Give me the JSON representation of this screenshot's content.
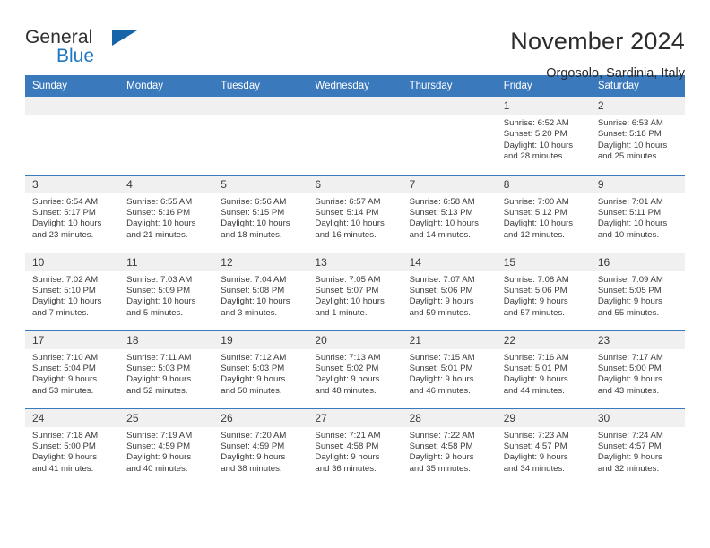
{
  "logo": {
    "text_primary": "General",
    "text_secondary": "Blue",
    "triangle_color": "#1565a8",
    "secondary_color": "#1f78c1"
  },
  "header": {
    "title": "November 2024",
    "subtitle": "Orgosolo, Sardinia, Italy"
  },
  "calendar": {
    "header_bg": "#3b79bd",
    "daynum_bg": "#f0f0f0",
    "weekday_headers": [
      "Sunday",
      "Monday",
      "Tuesday",
      "Wednesday",
      "Thursday",
      "Friday",
      "Saturday"
    ],
    "weeks": [
      [
        {
          "day": "",
          "blank": true
        },
        {
          "day": "",
          "blank": true
        },
        {
          "day": "",
          "blank": true
        },
        {
          "day": "",
          "blank": true
        },
        {
          "day": "",
          "blank": true
        },
        {
          "day": "1",
          "sunrise": "Sunrise: 6:52 AM",
          "sunset": "Sunset: 5:20 PM",
          "daylight_1": "Daylight: 10 hours",
          "daylight_2": "and 28 minutes."
        },
        {
          "day": "2",
          "sunrise": "Sunrise: 6:53 AM",
          "sunset": "Sunset: 5:18 PM",
          "daylight_1": "Daylight: 10 hours",
          "daylight_2": "and 25 minutes."
        }
      ],
      [
        {
          "day": "3",
          "sunrise": "Sunrise: 6:54 AM",
          "sunset": "Sunset: 5:17 PM",
          "daylight_1": "Daylight: 10 hours",
          "daylight_2": "and 23 minutes."
        },
        {
          "day": "4",
          "sunrise": "Sunrise: 6:55 AM",
          "sunset": "Sunset: 5:16 PM",
          "daylight_1": "Daylight: 10 hours",
          "daylight_2": "and 21 minutes."
        },
        {
          "day": "5",
          "sunrise": "Sunrise: 6:56 AM",
          "sunset": "Sunset: 5:15 PM",
          "daylight_1": "Daylight: 10 hours",
          "daylight_2": "and 18 minutes."
        },
        {
          "day": "6",
          "sunrise": "Sunrise: 6:57 AM",
          "sunset": "Sunset: 5:14 PM",
          "daylight_1": "Daylight: 10 hours",
          "daylight_2": "and 16 minutes."
        },
        {
          "day": "7",
          "sunrise": "Sunrise: 6:58 AM",
          "sunset": "Sunset: 5:13 PM",
          "daylight_1": "Daylight: 10 hours",
          "daylight_2": "and 14 minutes."
        },
        {
          "day": "8",
          "sunrise": "Sunrise: 7:00 AM",
          "sunset": "Sunset: 5:12 PM",
          "daylight_1": "Daylight: 10 hours",
          "daylight_2": "and 12 minutes."
        },
        {
          "day": "9",
          "sunrise": "Sunrise: 7:01 AM",
          "sunset": "Sunset: 5:11 PM",
          "daylight_1": "Daylight: 10 hours",
          "daylight_2": "and 10 minutes."
        }
      ],
      [
        {
          "day": "10",
          "sunrise": "Sunrise: 7:02 AM",
          "sunset": "Sunset: 5:10 PM",
          "daylight_1": "Daylight: 10 hours",
          "daylight_2": "and 7 minutes."
        },
        {
          "day": "11",
          "sunrise": "Sunrise: 7:03 AM",
          "sunset": "Sunset: 5:09 PM",
          "daylight_1": "Daylight: 10 hours",
          "daylight_2": "and 5 minutes."
        },
        {
          "day": "12",
          "sunrise": "Sunrise: 7:04 AM",
          "sunset": "Sunset: 5:08 PM",
          "daylight_1": "Daylight: 10 hours",
          "daylight_2": "and 3 minutes."
        },
        {
          "day": "13",
          "sunrise": "Sunrise: 7:05 AM",
          "sunset": "Sunset: 5:07 PM",
          "daylight_1": "Daylight: 10 hours",
          "daylight_2": "and 1 minute."
        },
        {
          "day": "14",
          "sunrise": "Sunrise: 7:07 AM",
          "sunset": "Sunset: 5:06 PM",
          "daylight_1": "Daylight: 9 hours",
          "daylight_2": "and 59 minutes."
        },
        {
          "day": "15",
          "sunrise": "Sunrise: 7:08 AM",
          "sunset": "Sunset: 5:06 PM",
          "daylight_1": "Daylight: 9 hours",
          "daylight_2": "and 57 minutes."
        },
        {
          "day": "16",
          "sunrise": "Sunrise: 7:09 AM",
          "sunset": "Sunset: 5:05 PM",
          "daylight_1": "Daylight: 9 hours",
          "daylight_2": "and 55 minutes."
        }
      ],
      [
        {
          "day": "17",
          "sunrise": "Sunrise: 7:10 AM",
          "sunset": "Sunset: 5:04 PM",
          "daylight_1": "Daylight: 9 hours",
          "daylight_2": "and 53 minutes."
        },
        {
          "day": "18",
          "sunrise": "Sunrise: 7:11 AM",
          "sunset": "Sunset: 5:03 PM",
          "daylight_1": "Daylight: 9 hours",
          "daylight_2": "and 52 minutes."
        },
        {
          "day": "19",
          "sunrise": "Sunrise: 7:12 AM",
          "sunset": "Sunset: 5:03 PM",
          "daylight_1": "Daylight: 9 hours",
          "daylight_2": "and 50 minutes."
        },
        {
          "day": "20",
          "sunrise": "Sunrise: 7:13 AM",
          "sunset": "Sunset: 5:02 PM",
          "daylight_1": "Daylight: 9 hours",
          "daylight_2": "and 48 minutes."
        },
        {
          "day": "21",
          "sunrise": "Sunrise: 7:15 AM",
          "sunset": "Sunset: 5:01 PM",
          "daylight_1": "Daylight: 9 hours",
          "daylight_2": "and 46 minutes."
        },
        {
          "day": "22",
          "sunrise": "Sunrise: 7:16 AM",
          "sunset": "Sunset: 5:01 PM",
          "daylight_1": "Daylight: 9 hours",
          "daylight_2": "and 44 minutes."
        },
        {
          "day": "23",
          "sunrise": "Sunrise: 7:17 AM",
          "sunset": "Sunset: 5:00 PM",
          "daylight_1": "Daylight: 9 hours",
          "daylight_2": "and 43 minutes."
        }
      ],
      [
        {
          "day": "24",
          "sunrise": "Sunrise: 7:18 AM",
          "sunset": "Sunset: 5:00 PM",
          "daylight_1": "Daylight: 9 hours",
          "daylight_2": "and 41 minutes."
        },
        {
          "day": "25",
          "sunrise": "Sunrise: 7:19 AM",
          "sunset": "Sunset: 4:59 PM",
          "daylight_1": "Daylight: 9 hours",
          "daylight_2": "and 40 minutes."
        },
        {
          "day": "26",
          "sunrise": "Sunrise: 7:20 AM",
          "sunset": "Sunset: 4:59 PM",
          "daylight_1": "Daylight: 9 hours",
          "daylight_2": "and 38 minutes."
        },
        {
          "day": "27",
          "sunrise": "Sunrise: 7:21 AM",
          "sunset": "Sunset: 4:58 PM",
          "daylight_1": "Daylight: 9 hours",
          "daylight_2": "and 36 minutes."
        },
        {
          "day": "28",
          "sunrise": "Sunrise: 7:22 AM",
          "sunset": "Sunset: 4:58 PM",
          "daylight_1": "Daylight: 9 hours",
          "daylight_2": "and 35 minutes."
        },
        {
          "day": "29",
          "sunrise": "Sunrise: 7:23 AM",
          "sunset": "Sunset: 4:57 PM",
          "daylight_1": "Daylight: 9 hours",
          "daylight_2": "and 34 minutes."
        },
        {
          "day": "30",
          "sunrise": "Sunrise: 7:24 AM",
          "sunset": "Sunset: 4:57 PM",
          "daylight_1": "Daylight: 9 hours",
          "daylight_2": "and 32 minutes."
        }
      ]
    ]
  }
}
